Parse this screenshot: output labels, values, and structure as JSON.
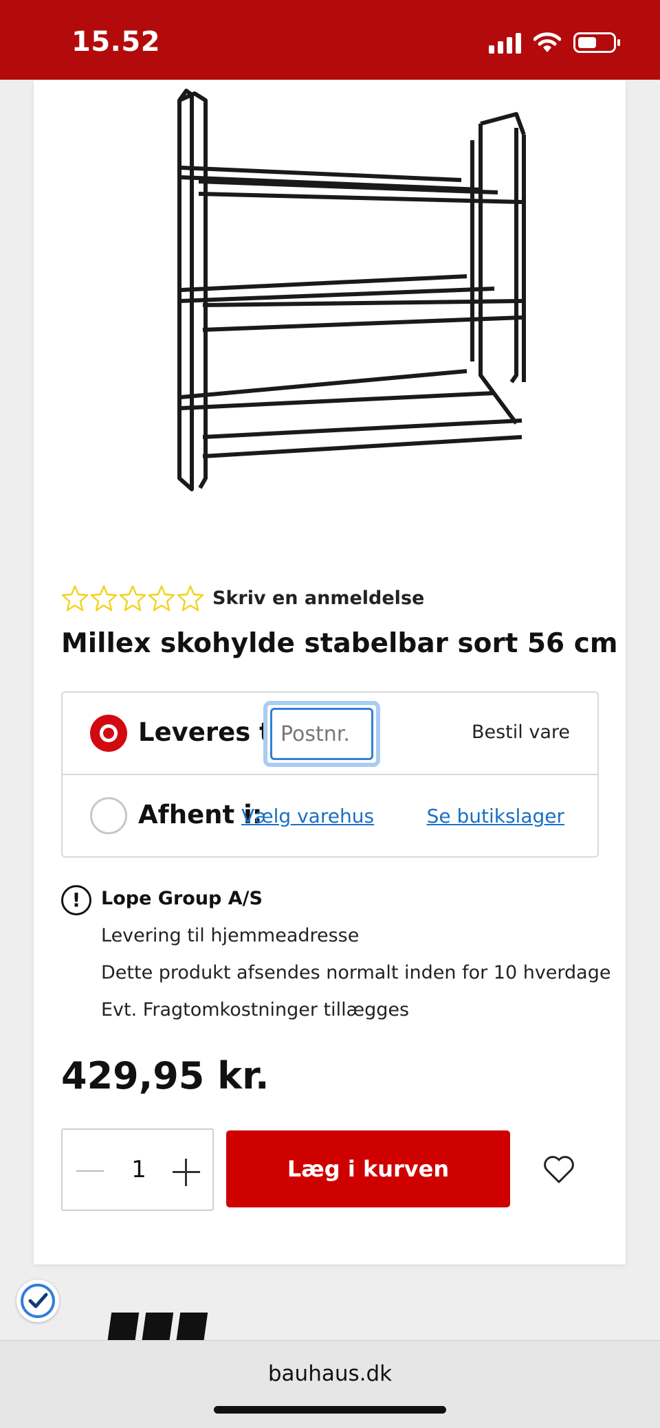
{
  "status_bar": {
    "time": "15.52",
    "icons": [
      "signal-icon",
      "wifi-icon",
      "battery-icon"
    ]
  },
  "product": {
    "image": "shoe-rack-image",
    "rating": {
      "stars_filled": 0,
      "stars_total": 5,
      "review_link": "Skriv en anmeldelse"
    },
    "title": "Millex skohylde stabelbar sort 56 cm"
  },
  "delivery": {
    "deliver_label": "Leveres til:",
    "postcode_placeholder": "Postnr.",
    "order_label": "Bestil vare",
    "pickup_label": "Afhent i:",
    "choose_store_link": "Vælg varehus",
    "stock_link": "Se butikslager",
    "selected": "deliver"
  },
  "info": {
    "supplier": "Lope Group A/S",
    "lines": [
      "Levering til hjemmeadresse",
      "Dette produkt afsendes normalt inden for 10 hverdage",
      "Evt. Fragtomkostninger tillægges"
    ]
  },
  "price": "429,95 kr.",
  "cart": {
    "quantity": "1",
    "add_label": "Læg i kurven"
  },
  "browser": {
    "url": "bauhaus.dk"
  },
  "colors": {
    "brand_red": "#b30b0b",
    "button_red": "#cf0000",
    "link_blue": "#1a6fc4",
    "star_yellow": "#f2d21b"
  }
}
